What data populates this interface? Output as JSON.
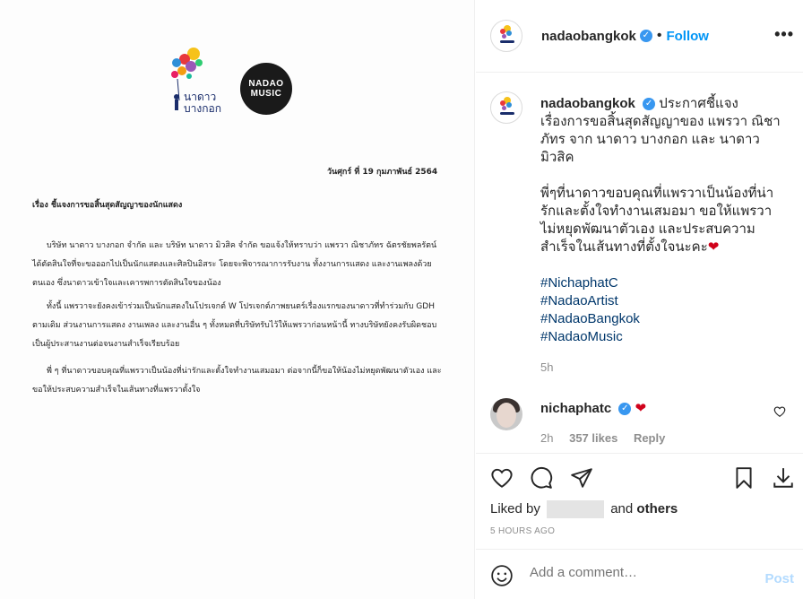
{
  "post": {
    "username": "nadaobangkok",
    "follow_label": "Follow",
    "separator": "•",
    "more_label": "•••",
    "caption_lines": [
      "ประกาศชี้แจง",
      "เรื่องการขอสิ้นสุดสัญญาของ แพรวา ณิชา",
      "ภัทร จาก นาดาว บางกอก และ นาดาว",
      "มิวสิค"
    ],
    "caption_body": [
      "พี่ๆที่นาดาวขอบคุณที่แพรวาเป็นน้องที่น่า",
      "รักและตั้งใจทำงานเสมอมา ขอให้แพรวา",
      "ไม่หยุดพัฒนาตัวเอง และประสบความ",
      "สำเร็จในเส้นทางที่ตั้งใจนะคะ"
    ],
    "caption_emoji": "❤",
    "hashtags": [
      "#NichaphatC",
      "#NadaoArtist",
      "#NadaoBangkok",
      "#NadaoMusic"
    ],
    "caption_time": "5h",
    "comment": {
      "username": "nichaphatc",
      "text": "❤",
      "time": "2h",
      "likes": "357 likes",
      "reply": "Reply"
    },
    "liked_by_prefix": "Liked by",
    "liked_by_and": "and",
    "liked_by_others": "others",
    "time_ago": "5 HOURS AGO",
    "add_comment_placeholder": "Add a comment…",
    "post_label": "Post"
  },
  "image": {
    "logo_text": "นาดาว บางกอก",
    "music_logo_line1": "NADAO",
    "music_logo_line2": "MUSIC",
    "date": "วันศุกร์ ที่ 19 กุมภาพันธ์ 2564",
    "subject": "เรื่อง  ชี้แจงการขอสิ้นสุดสัญญาของนักแสดง",
    "paragraph1": "บริษัท นาดาว บางกอก จำกัด และ บริษัท นาดาว มิวสิค จำกัด ขอแจ้งให้ทราบว่า แพรวา ณิชาภัทร ฉัตรชัยพลรัตน์ ได้ตัดสินใจที่จะขอออกไปเป็นนักแสดงและศิลปินอิสระ โดยจะพิจารณาการรับงาน ทั้งงานการแสดง และงานเพลงด้วยตนเอง ซึ่งนาดาวเข้าใจและเคารพการตัดสินใจของน้อง",
    "paragraph2": "ทั้งนี้ แพรวาจะยังคงเข้าร่วมเป็นนักแสดงในโปรเจกต์ W โปรเจกต์ภาพยนตร์เรื่องแรกของนาดาวที่ทำร่วมกับ GDH ตามเดิม ส่วนงานการแสดง งานเพลง และงานอื่น ๆ ทั้งหมดที่บริษัทรับไว้ให้แพรวาก่อนหน้านี้ ทางบริษัทยังคงรับผิดชอบเป็นผู้ประสานงานต่อจนงานสำเร็จเรียบร้อย",
    "paragraph3": "พี่ ๆ ที่นาดาวขอบคุณที่แพรวาเป็นน้องที่น่ารักและตั้งใจทำงานเสมอมา ต่อจากนี้ก็ขอให้น้องไม่หยุดพัฒนาตัวเอง และขอให้ประสบความสำเร็จในเส้นทางที่แพรวาตั้งใจ"
  },
  "colors": {
    "accent": "#0095f6",
    "heart": "#ed4956",
    "hashtag": "#00376b",
    "muted": "#8e8e8e"
  }
}
